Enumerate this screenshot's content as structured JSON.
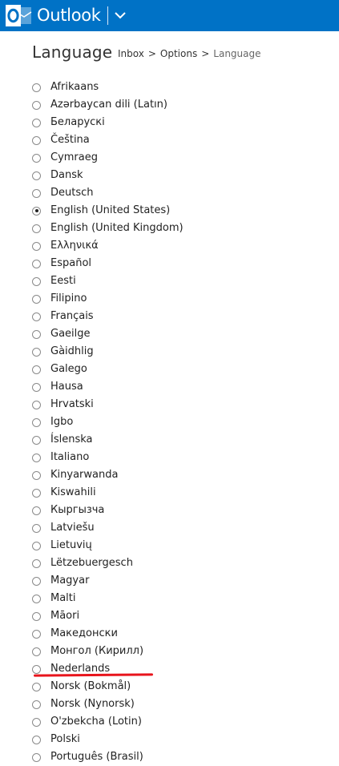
{
  "header": {
    "app_name": "Outlook",
    "brand_color": "#0072c6",
    "logo_icon": "outlook-logo-icon",
    "menu_icon": "chevron-down-icon"
  },
  "page": {
    "title": "Language",
    "breadcrumb": {
      "inbox": "Inbox",
      "separator": ">",
      "options": "Options",
      "current": "Language"
    }
  },
  "languages": [
    {
      "label": "Afrikaans",
      "selected": false
    },
    {
      "label": "Azərbaycan dili (Latın)",
      "selected": false
    },
    {
      "label": "Беларускі",
      "selected": false
    },
    {
      "label": "Čeština",
      "selected": false
    },
    {
      "label": "Cymraeg",
      "selected": false
    },
    {
      "label": "Dansk",
      "selected": false
    },
    {
      "label": "Deutsch",
      "selected": false
    },
    {
      "label": "English (United States)",
      "selected": true
    },
    {
      "label": "English (United Kingdom)",
      "selected": false
    },
    {
      "label": "Ελληνικά",
      "selected": false
    },
    {
      "label": "Español",
      "selected": false
    },
    {
      "label": "Eesti",
      "selected": false
    },
    {
      "label": "Filipino",
      "selected": false
    },
    {
      "label": "Français",
      "selected": false
    },
    {
      "label": "Gaeilge",
      "selected": false
    },
    {
      "label": "Gàidhlig",
      "selected": false
    },
    {
      "label": "Galego",
      "selected": false
    },
    {
      "label": "Hausa",
      "selected": false
    },
    {
      "label": "Hrvatski",
      "selected": false
    },
    {
      "label": "Igbo",
      "selected": false
    },
    {
      "label": "Íslenska",
      "selected": false
    },
    {
      "label": "Italiano",
      "selected": false
    },
    {
      "label": "Kinyarwanda",
      "selected": false
    },
    {
      "label": "Kiswahili",
      "selected": false
    },
    {
      "label": "Кыргызча",
      "selected": false
    },
    {
      "label": "Latviešu",
      "selected": false
    },
    {
      "label": "Lietuvių",
      "selected": false
    },
    {
      "label": "Lëtzebuergesch",
      "selected": false
    },
    {
      "label": "Magyar",
      "selected": false
    },
    {
      "label": "Malti",
      "selected": false
    },
    {
      "label": "Māori",
      "selected": false
    },
    {
      "label": "Македонски",
      "selected": false
    },
    {
      "label": "Монгол (Кирилл)",
      "selected": false
    },
    {
      "label": "Nederlands",
      "selected": false
    },
    {
      "label": "Norsk (Bokmål)",
      "selected": false
    },
    {
      "label": "Norsk (Nynorsk)",
      "selected": false
    },
    {
      "label": "O'zbekcha (Lotin)",
      "selected": false
    },
    {
      "label": "Polski",
      "selected": false
    },
    {
      "label": "Português (Brasil)",
      "selected": false
    }
  ],
  "annotation": {
    "underline_color": "#e8141c",
    "underlined_item": "Nederlands"
  }
}
